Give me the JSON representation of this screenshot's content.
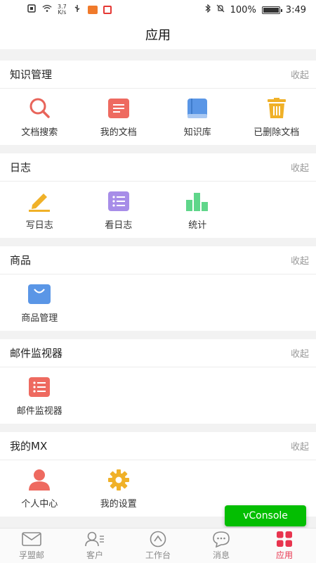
{
  "status_bar": {
    "net_speed_value": "3.7",
    "net_speed_unit": "K/s",
    "battery": "100%",
    "time": "3:49"
  },
  "title": "应用",
  "sections": [
    {
      "title": "知识管理",
      "collapse_label": "收起",
      "items": [
        {
          "label": "文档搜索",
          "icon": "search-icon",
          "color": "#e8645a"
        },
        {
          "label": "我的文档",
          "icon": "document-icon",
          "color": "#ee6a60"
        },
        {
          "label": "知识库",
          "icon": "book-icon",
          "color": "#5a96e6"
        },
        {
          "label": "已删除文档",
          "icon": "trash-icon",
          "color": "#f0b128"
        }
      ]
    },
    {
      "title": "日志",
      "collapse_label": "收起",
      "items": [
        {
          "label": "写日志",
          "icon": "pencil-icon",
          "color": "#f0b128"
        },
        {
          "label": "看日志",
          "icon": "list-icon",
          "color": "#a78de8"
        },
        {
          "label": "统计",
          "icon": "bar-chart-icon",
          "color": "#5fd68a"
        }
      ]
    },
    {
      "title": "商品",
      "collapse_label": "收起",
      "items": [
        {
          "label": "商品管理",
          "icon": "shopping-bag-icon",
          "color": "#5a96e6"
        }
      ]
    },
    {
      "title": "邮件监视器",
      "collapse_label": "收起",
      "items": [
        {
          "label": "邮件监视器",
          "icon": "list-icon",
          "color": "#ee6a60"
        }
      ]
    },
    {
      "title": "我的MX",
      "collapse_label": "收起",
      "items": [
        {
          "label": "个人中心",
          "icon": "person-icon",
          "color": "#ee6a60"
        },
        {
          "label": "我的设置",
          "icon": "gear-icon",
          "color": "#f0b128"
        }
      ]
    }
  ],
  "vconsole_label": "vConsole",
  "tabs": [
    {
      "label": "孚盟邮",
      "icon": "mail-icon"
    },
    {
      "label": "客户",
      "icon": "contacts-icon"
    },
    {
      "label": "工作台",
      "icon": "compass-icon"
    },
    {
      "label": "消息",
      "icon": "chat-icon"
    },
    {
      "label": "应用",
      "icon": "apps-grid-icon",
      "active": true
    }
  ],
  "colors": {
    "accent": "#e8344e",
    "vconsole": "#04be02"
  }
}
